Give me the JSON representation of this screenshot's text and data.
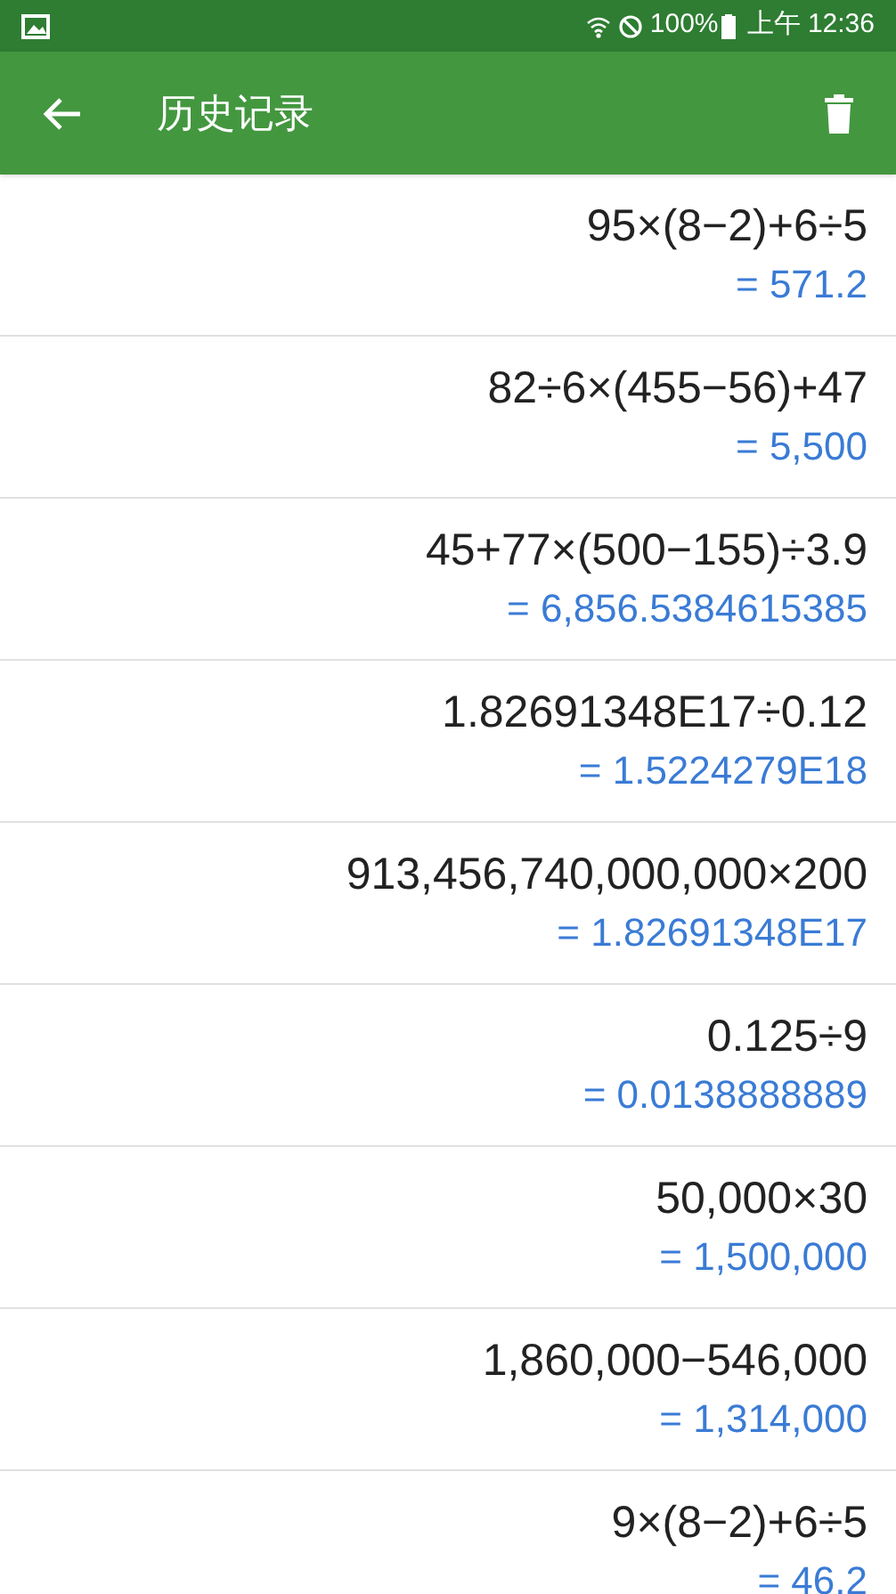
{
  "status_bar": {
    "battery": "100%",
    "time": "上午 12:36"
  },
  "app_bar": {
    "title": "历史记录"
  },
  "history": [
    {
      "expression": "95×(8−2)+6÷5",
      "result": "= 571.2"
    },
    {
      "expression": "82÷6×(455−56)+47",
      "result": "= 5,500"
    },
    {
      "expression": "45+77×(500−155)÷3.9",
      "result": "= 6,856.5384615385"
    },
    {
      "expression": "1.82691348E17÷0.12",
      "result": "= 1.5224279E18"
    },
    {
      "expression": "913,456,740,000,000×200",
      "result": "= 1.82691348E17"
    },
    {
      "expression": "0.125÷9",
      "result": "= 0.0138888889"
    },
    {
      "expression": "50,000×30",
      "result": "= 1,500,000"
    },
    {
      "expression": "1,860,000−546,000",
      "result": "= 1,314,000"
    },
    {
      "expression": "9×(8−2)+6÷5",
      "result": "= 46.2"
    }
  ]
}
